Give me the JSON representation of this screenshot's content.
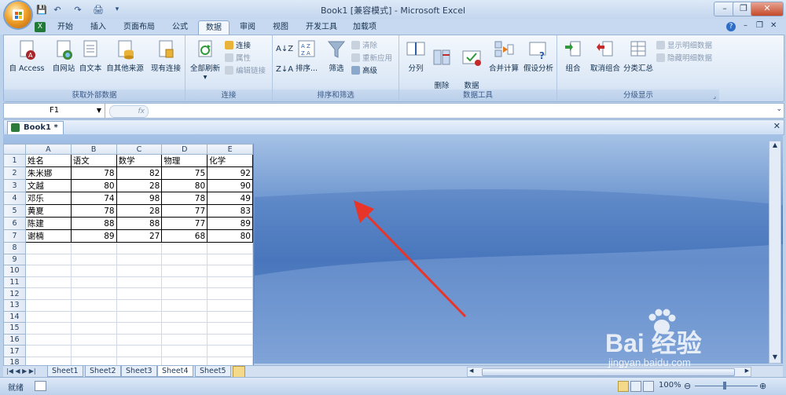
{
  "window": {
    "title": "Book1  [兼容模式] - Microsoft Excel"
  },
  "quick_access": {
    "save": "💾",
    "undo": "↶",
    "redo": "↷"
  },
  "tabs": [
    "开始",
    "插入",
    "页面布局",
    "公式",
    "数据",
    "审阅",
    "视图",
    "开发工具",
    "加载项"
  ],
  "active_tab": "数据",
  "ribbon": {
    "groups": {
      "external": {
        "label": "获取外部数据",
        "buttons": [
          "自 Access",
          "自网站",
          "自文本",
          "自其他来源",
          "现有连接"
        ]
      },
      "connections": {
        "label": "连接",
        "refresh": "全部刷新",
        "small": [
          "连接",
          "属性",
          "编辑链接"
        ]
      },
      "sort": {
        "label": "排序和筛选",
        "sort": "排序...",
        "filter": "筛选",
        "small": [
          "清除",
          "重新应用",
          "高级"
        ]
      },
      "tools": {
        "label": "数据工具",
        "buttons": [
          "分列",
          "删除\n重复项",
          "数据\n有效性",
          "合并计算",
          "假设分析"
        ]
      },
      "outline": {
        "label": "分级显示",
        "buttons": [
          "组合",
          "取消组合",
          "分类汇总"
        ],
        "small": [
          "显示明细数据",
          "隐藏明细数据"
        ]
      }
    }
  },
  "formula_bar": {
    "name_box": "F1",
    "fx": "fx",
    "value": ""
  },
  "workbook": {
    "tab": "Book1 *"
  },
  "sheet": {
    "columns": [
      "A",
      "B",
      "C",
      "D",
      "E"
    ],
    "rows": [
      [
        "姓名",
        "语文",
        "数学",
        "物理",
        "化学"
      ],
      [
        "朱米娜",
        "78",
        "82",
        "75",
        "92"
      ],
      [
        "文越",
        "80",
        "28",
        "80",
        "90"
      ],
      [
        "邓乐",
        "74",
        "98",
        "78",
        "49"
      ],
      [
        "黄夏",
        "78",
        "28",
        "77",
        "83"
      ],
      [
        "陈建",
        "88",
        "88",
        "77",
        "89"
      ],
      [
        "谢楠",
        "89",
        "27",
        "68",
        "80"
      ]
    ],
    "row_count": 19
  },
  "sheet_tabs": [
    "Sheet1",
    "Sheet2",
    "Sheet3",
    "Sheet4",
    "Sheet5"
  ],
  "active_sheet": "Sheet4",
  "status": {
    "ready": "就绪",
    "zoom": "100%"
  },
  "watermark": {
    "text": "Bai 经验",
    "url": "jingyan.baidu.com"
  },
  "colors": {
    "accent": "#4f81bd",
    "arrow": "#e8352a"
  }
}
